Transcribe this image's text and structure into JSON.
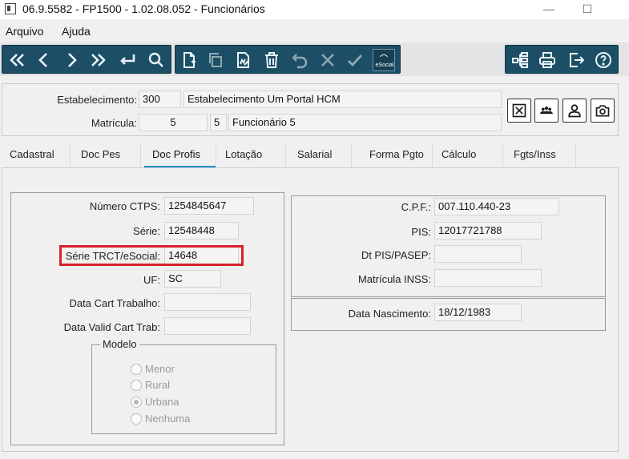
{
  "window": {
    "title": "06.9.5582 - FP1500 - 1.02.08.052 - Funcionários",
    "minimize": "—",
    "maximize": "☐"
  },
  "menu": [
    "Arquivo",
    "Ajuda"
  ],
  "toolbar": {
    "esocial_label": "eSocial"
  },
  "header": {
    "estabelecimento_label": "Estabelecimento:",
    "estabelecimento_code": "300",
    "estabelecimento_name": "Estabelecimento Um Portal HCM",
    "matricula_label": "Matrícula:",
    "matricula_code": "5",
    "matricula_seq": "5",
    "matricula_name": "Funcionário 5"
  },
  "tabs": [
    {
      "label": "Cadastral"
    },
    {
      "label": "Doc Pes"
    },
    {
      "label": "Doc Profis",
      "active": true
    },
    {
      "label": "Lotação"
    },
    {
      "label": "Salarial"
    },
    {
      "label": "Forma Pgto"
    },
    {
      "label": "Cálculo"
    },
    {
      "label": "Fgts/Inss"
    }
  ],
  "left_panel": {
    "numero_ctps_label": "Número CTPS:",
    "numero_ctps": "1254845647",
    "serie_label": "Série:",
    "serie": "12548448",
    "serie_trct_label": "Série TRCT/eSocial:",
    "serie_trct": "14648",
    "uf_label": "UF:",
    "uf": "SC",
    "data_cart_label": "Data Cart Trabalho:",
    "data_cart": "",
    "data_valid_label": "Data Valid Cart Trab:",
    "data_valid": "",
    "modelo_label": "Modelo",
    "modelo_options": [
      "Menor",
      "Rural",
      "Urbana",
      "Nenhuma"
    ],
    "modelo_selected": "Urbana"
  },
  "right_panel": {
    "cpf_label": "C.P.F.:",
    "cpf": "007.110.440-23",
    "pis_label": "PIS:",
    "pis": "12017721788",
    "dt_pis_label": "Dt PIS/PASEP:",
    "dt_pis": "",
    "matricula_inss_label": "Matrícula INSS:",
    "matricula_inss": "",
    "data_nasc_label": "Data Nascimento:",
    "data_nasc": "18/12/1983"
  },
  "colors": {
    "toolbar": "#1c4f66",
    "tab_active_underline": "#1f8ec3",
    "highlight": "#d8202a"
  }
}
